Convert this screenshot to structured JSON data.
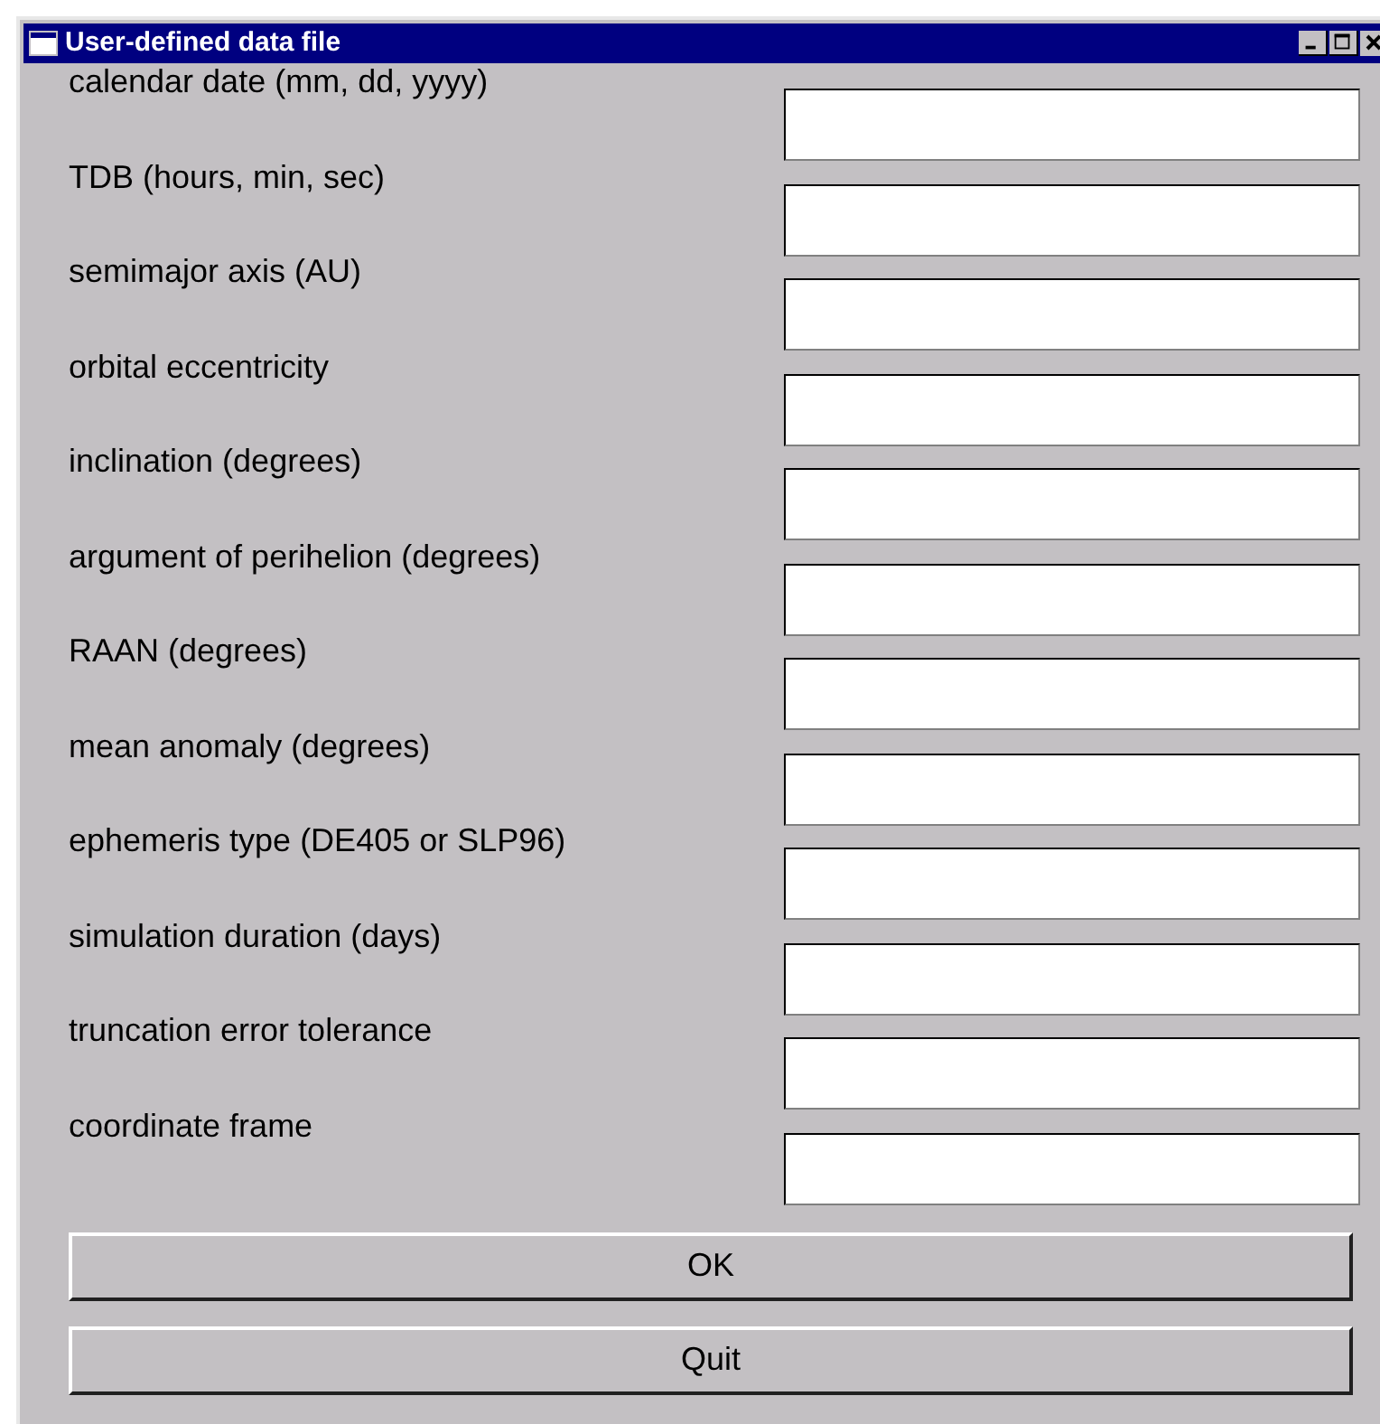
{
  "window": {
    "title": "User-defined data file"
  },
  "fields": [
    {
      "label": "calendar date (mm, dd, yyyy)"
    },
    {
      "label": "TDB (hours, min, sec)"
    },
    {
      "label": "semimajor axis (AU)"
    },
    {
      "label": "orbital eccentricity"
    },
    {
      "label": "inclination (degrees)"
    },
    {
      "label": "argument of perihelion (degrees)"
    },
    {
      "label": "RAAN (degrees)"
    },
    {
      "label": "mean anomaly (degrees)"
    },
    {
      "label": "ephemeris type (DE405 or SLP96)"
    },
    {
      "label": "simulation duration (days)"
    },
    {
      "label": "truncation error tolerance"
    },
    {
      "label": "coordinate frame"
    }
  ],
  "buttons": [
    "OK",
    "Quit"
  ]
}
